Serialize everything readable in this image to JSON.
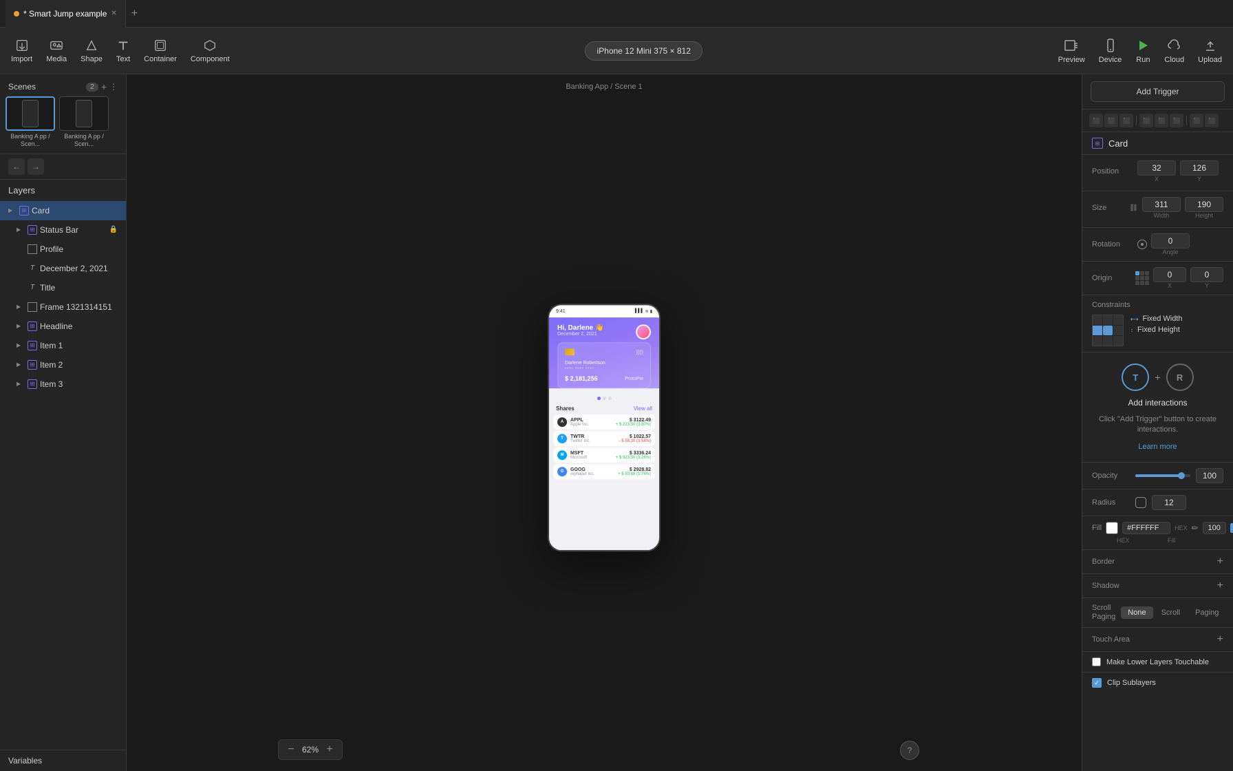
{
  "app": {
    "title": "Smart Jump example",
    "tab_dot": true,
    "tab_label": "* Smart Jump example",
    "tab_close": "✕"
  },
  "toolbar": {
    "import_label": "Import",
    "media_label": "Media",
    "shape_label": "Shape",
    "text_label": "Text",
    "container_label": "Container",
    "component_label": "Component",
    "device_label": "iPhone 12 Mini  375 × 812",
    "preview_label": "Preview",
    "device_menu_label": "Device",
    "run_label": "Run",
    "cloud_label": "Cloud",
    "upload_label": "Upload"
  },
  "scenes": {
    "header": "Scenes",
    "count": "2",
    "items": [
      {
        "label": "Banking A\npp / Scen..."
      },
      {
        "label": "Banking A\npp / Scen..."
      }
    ]
  },
  "layers": {
    "header": "Layers",
    "items": [
      {
        "name": "Card",
        "type": "comp",
        "indent": 0,
        "expanded": false,
        "selected": true,
        "locked": false
      },
      {
        "name": "Status Bar",
        "type": "comp",
        "indent": 1,
        "expanded": false,
        "selected": false,
        "locked": true
      },
      {
        "name": "Profile",
        "type": "frame",
        "indent": 1,
        "expanded": false,
        "selected": false,
        "locked": false
      },
      {
        "name": "December 2, 2021",
        "type": "text",
        "indent": 1,
        "expanded": false,
        "selected": false,
        "locked": false
      },
      {
        "name": "Title",
        "type": "text",
        "indent": 1,
        "expanded": false,
        "selected": false,
        "locked": false
      },
      {
        "name": "Frame 1321314151",
        "type": "frame",
        "indent": 1,
        "expanded": false,
        "selected": false,
        "locked": false
      },
      {
        "name": "Headline",
        "type": "comp",
        "indent": 1,
        "expanded": false,
        "selected": false,
        "locked": false
      },
      {
        "name": "Item 1",
        "type": "comp",
        "indent": 1,
        "expanded": false,
        "selected": false,
        "locked": false
      },
      {
        "name": "Item 2",
        "type": "comp",
        "indent": 1,
        "expanded": false,
        "selected": false,
        "locked": false
      },
      {
        "name": "Item 3",
        "type": "comp",
        "indent": 1,
        "expanded": false,
        "selected": false,
        "locked": false
      }
    ]
  },
  "variables": {
    "header": "Variables"
  },
  "canvas": {
    "label": "Banking App / Scene 1",
    "zoom": "62%"
  },
  "phone": {
    "time": "9:41",
    "greeting": "Hi, Darlene 👋",
    "date": "December 2, 2021",
    "card_name": "Darlene Robertson",
    "card_number": "•••• •••• ••••",
    "card_balance": "$ 2,181,256",
    "card_brand": "ProtoPie",
    "shares_title": "Shares",
    "shares_link": "View all",
    "stocks": [
      {
        "ticker": "APPL",
        "company": "Apple Inc.",
        "value": "$ 3122.49",
        "change": "+ $ 223.30 (3.80%)",
        "positive": true,
        "color": "#333"
      },
      {
        "ticker": "TWTR",
        "company": "Twitter Inc.",
        "value": "$ 1022.57",
        "change": "- $ 56.30 (3.58%)",
        "positive": false,
        "color": "#1DA1F2"
      },
      {
        "ticker": "MSFT",
        "company": "Microsoft",
        "value": "$ 3336.24",
        "change": "+ $ 923.30 (3.26%)",
        "positive": true,
        "color": "#00a4ef"
      },
      {
        "ticker": "GOOG",
        "company": "Alphabet Inc.",
        "value": "$ 2928.82",
        "change": "+ $ 50.88 (1.76%)",
        "positive": true,
        "color": "#4285f4"
      }
    ]
  },
  "right_panel": {
    "add_trigger_label": "Add Trigger",
    "card_label": "Card",
    "position": {
      "x": "32",
      "y": "126",
      "x_label": "X",
      "y_label": "Y"
    },
    "size": {
      "width": "311",
      "height": "190",
      "width_label": "Width",
      "height_label": "Height"
    },
    "rotation": {
      "angle": "0",
      "label": "Angle",
      "section": "Rotation"
    },
    "origin": {
      "x": "0",
      "y": "0",
      "x_label": "X",
      "y_label": "Y"
    },
    "constraints": {
      "label": "Constraints",
      "fixed_width": "Fixed Width",
      "fixed_height": "Fixed Height"
    },
    "interactions": {
      "t_label": "T",
      "r_label": "R",
      "add_label": "Add interactions",
      "desc": "Click \"Add Trigger\" button\nto create interactions.",
      "learn_more": "Learn more"
    },
    "opacity": {
      "label": "Opacity",
      "value": "100"
    },
    "radius": {
      "label": "Radius",
      "value": "12"
    },
    "fill": {
      "label": "Fill",
      "hex": "#FFFFFF",
      "hex_label": "HEX",
      "fill_label": "Fill",
      "opacity": "100"
    },
    "border": {
      "label": "Border"
    },
    "shadow": {
      "label": "Shadow"
    },
    "scroll_paging": {
      "label": "Scroll\nPaging",
      "options": [
        "None",
        "Scroll",
        "Paging"
      ],
      "active": "None"
    },
    "touch_area": {
      "label": "Touch Area"
    },
    "make_lower_layers": "Make Lower Layers Touchable",
    "clip_sublayers": "Clip Sublayers"
  }
}
